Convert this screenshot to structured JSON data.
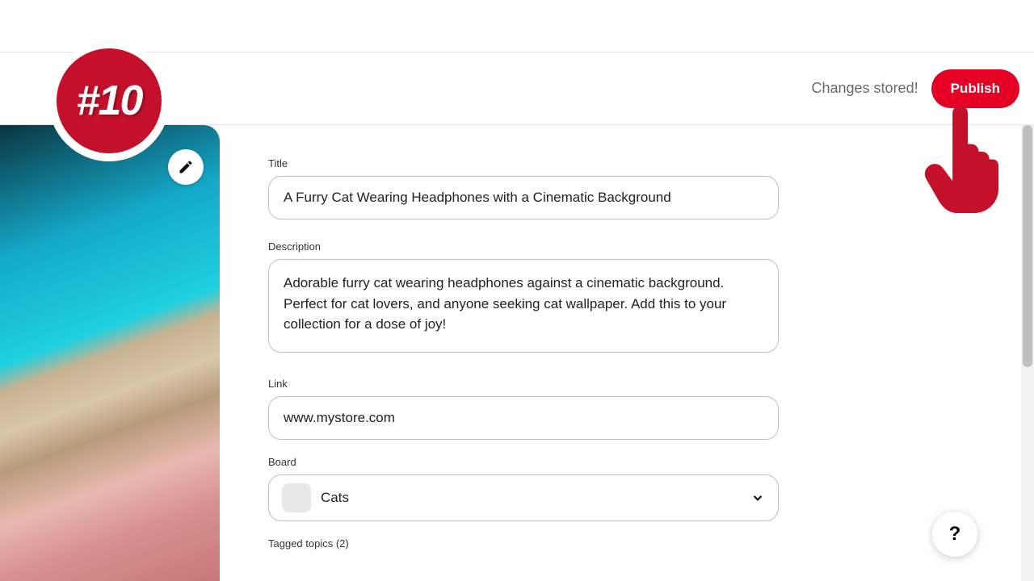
{
  "badge": {
    "text": "#10"
  },
  "header": {
    "status": "Changes stored!",
    "publish_label": "Publish"
  },
  "form": {
    "title_label": "Title",
    "title_value": "A Furry Cat Wearing Headphones with a Cinematic Background",
    "description_label": "Description",
    "description_value": "Adorable furry cat wearing headphones against a cinematic background. Perfect for cat lovers, and anyone seeking cat wallpaper. Add this to your collection for a dose of joy!",
    "link_label": "Link",
    "link_value": "www.mystore.com",
    "board_label": "Board",
    "board_value": "Cats",
    "tagged_label": "Tagged topics (2)"
  },
  "help": {
    "label": "?"
  }
}
